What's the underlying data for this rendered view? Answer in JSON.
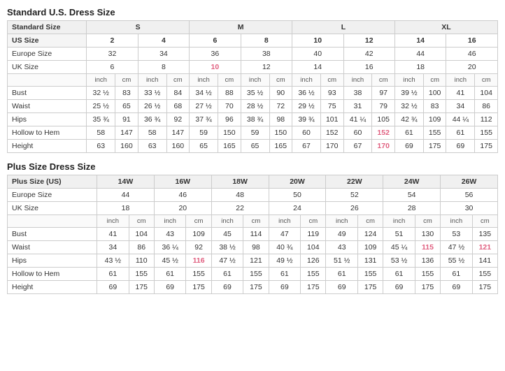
{
  "standard_title": "Standard U.S. Dress Size",
  "plus_title": "Plus Size Dress Size",
  "standard_table": {
    "size_row": [
      "Standard Size",
      "S",
      "",
      "",
      "",
      "M",
      "",
      "",
      "",
      "L",
      "",
      "",
      "",
      "XL",
      "",
      "",
      ""
    ],
    "us_size_row": [
      "US Size",
      "2",
      "",
      "4",
      "",
      "6",
      "",
      "8",
      "",
      "10",
      "",
      "12",
      "",
      "14",
      "",
      "16",
      ""
    ],
    "europe_row": [
      "Europe Size",
      "32",
      "",
      "34",
      "",
      "36",
      "",
      "38",
      "",
      "40",
      "",
      "42",
      "",
      "44",
      "",
      "46",
      ""
    ],
    "uk_row": [
      "UK Size",
      "6",
      "",
      "8",
      "",
      "10",
      "",
      "12",
      "",
      "14",
      "",
      "16",
      "",
      "18",
      "",
      "20",
      ""
    ],
    "unit_row": [
      "",
      "inch",
      "cm",
      "inch",
      "cm",
      "inch",
      "cm",
      "inch",
      "cm",
      "inch",
      "cm",
      "inch",
      "cm",
      "inch",
      "cm",
      "inch",
      "cm"
    ],
    "bust_row": [
      "Bust",
      "32 ½",
      "83",
      "33 ½",
      "84",
      "34 ½",
      "88",
      "35 ½",
      "90",
      "36 ½",
      "93",
      "38",
      "97",
      "39 ½",
      "100",
      "41",
      "104"
    ],
    "waist_row": [
      "Waist",
      "25 ½",
      "65",
      "26 ½",
      "68",
      "27 ½",
      "70",
      "28 ½",
      "72",
      "29 ½",
      "75",
      "31",
      "79",
      "32 ½",
      "83",
      "34",
      "86"
    ],
    "hips_row": [
      "Hips",
      "35 ¾",
      "91",
      "36 ¾",
      "92",
      "37 ¾",
      "96",
      "38 ¾",
      "98",
      "39 ¾",
      "101",
      "41 ¼",
      "105",
      "42 ¾",
      "109",
      "44 ¼",
      "112"
    ],
    "hollow_row": [
      "Hollow to Hem",
      "58",
      "147",
      "58",
      "147",
      "59",
      "150",
      "59",
      "150",
      "60",
      "152",
      "60",
      "152",
      "61",
      "155",
      "61",
      "155"
    ],
    "height_row": [
      "Height",
      "63",
      "160",
      "63",
      "160",
      "65",
      "165",
      "65",
      "165",
      "67",
      "170",
      "67",
      "170",
      "69",
      "175",
      "69",
      "175"
    ]
  },
  "plus_table": {
    "size_row": [
      "Plus Size (US)",
      "14W",
      "",
      "16W",
      "",
      "18W",
      "",
      "20W",
      "",
      "22W",
      "",
      "24W",
      "",
      "26W",
      ""
    ],
    "europe_row": [
      "Europe Size",
      "44",
      "",
      "46",
      "",
      "48",
      "",
      "50",
      "",
      "52",
      "",
      "54",
      "",
      "56",
      ""
    ],
    "uk_row": [
      "UK Size",
      "18",
      "",
      "20",
      "",
      "22",
      "",
      "24",
      "",
      "26",
      "",
      "28",
      "",
      "30",
      ""
    ],
    "unit_row": [
      "",
      "inch",
      "cm",
      "inch",
      "cm",
      "inch",
      "cm",
      "inch",
      "cm",
      "inch",
      "cm",
      "inch",
      "cm",
      "inch",
      "cm"
    ],
    "bust_row": [
      "Bust",
      "41",
      "104",
      "43",
      "109",
      "45",
      "114",
      "47",
      "119",
      "49",
      "124",
      "51",
      "130",
      "53",
      "135"
    ],
    "waist_row": [
      "Waist",
      "34",
      "86",
      "36 ¼",
      "92",
      "38 ½",
      "98",
      "40 ¾",
      "104",
      "43",
      "109",
      "45 ¼",
      "115",
      "47 ½",
      "121"
    ],
    "hips_row": [
      "Hips",
      "43 ½",
      "110",
      "45 ½",
      "116",
      "47 ½",
      "121",
      "49 ½",
      "126",
      "51 ½",
      "131",
      "53 ½",
      "136",
      "55 ½",
      "141"
    ],
    "hollow_row": [
      "Hollow to Hem",
      "61",
      "155",
      "61",
      "155",
      "61",
      "155",
      "61",
      "155",
      "61",
      "155",
      "61",
      "155",
      "61",
      "155"
    ],
    "height_row": [
      "Height",
      "69",
      "175",
      "69",
      "175",
      "69",
      "175",
      "69",
      "175",
      "69",
      "175",
      "69",
      "175",
      "69",
      "175"
    ]
  },
  "pink_highlights": {
    "standard": {
      "uk_10": "10",
      "hollow_152a": "152",
      "hollow_152b": "152",
      "height_170a": "170",
      "height_170b": "170"
    },
    "plus": {
      "waist_115": "115",
      "waist_121": "121",
      "hips_116": "116"
    }
  }
}
